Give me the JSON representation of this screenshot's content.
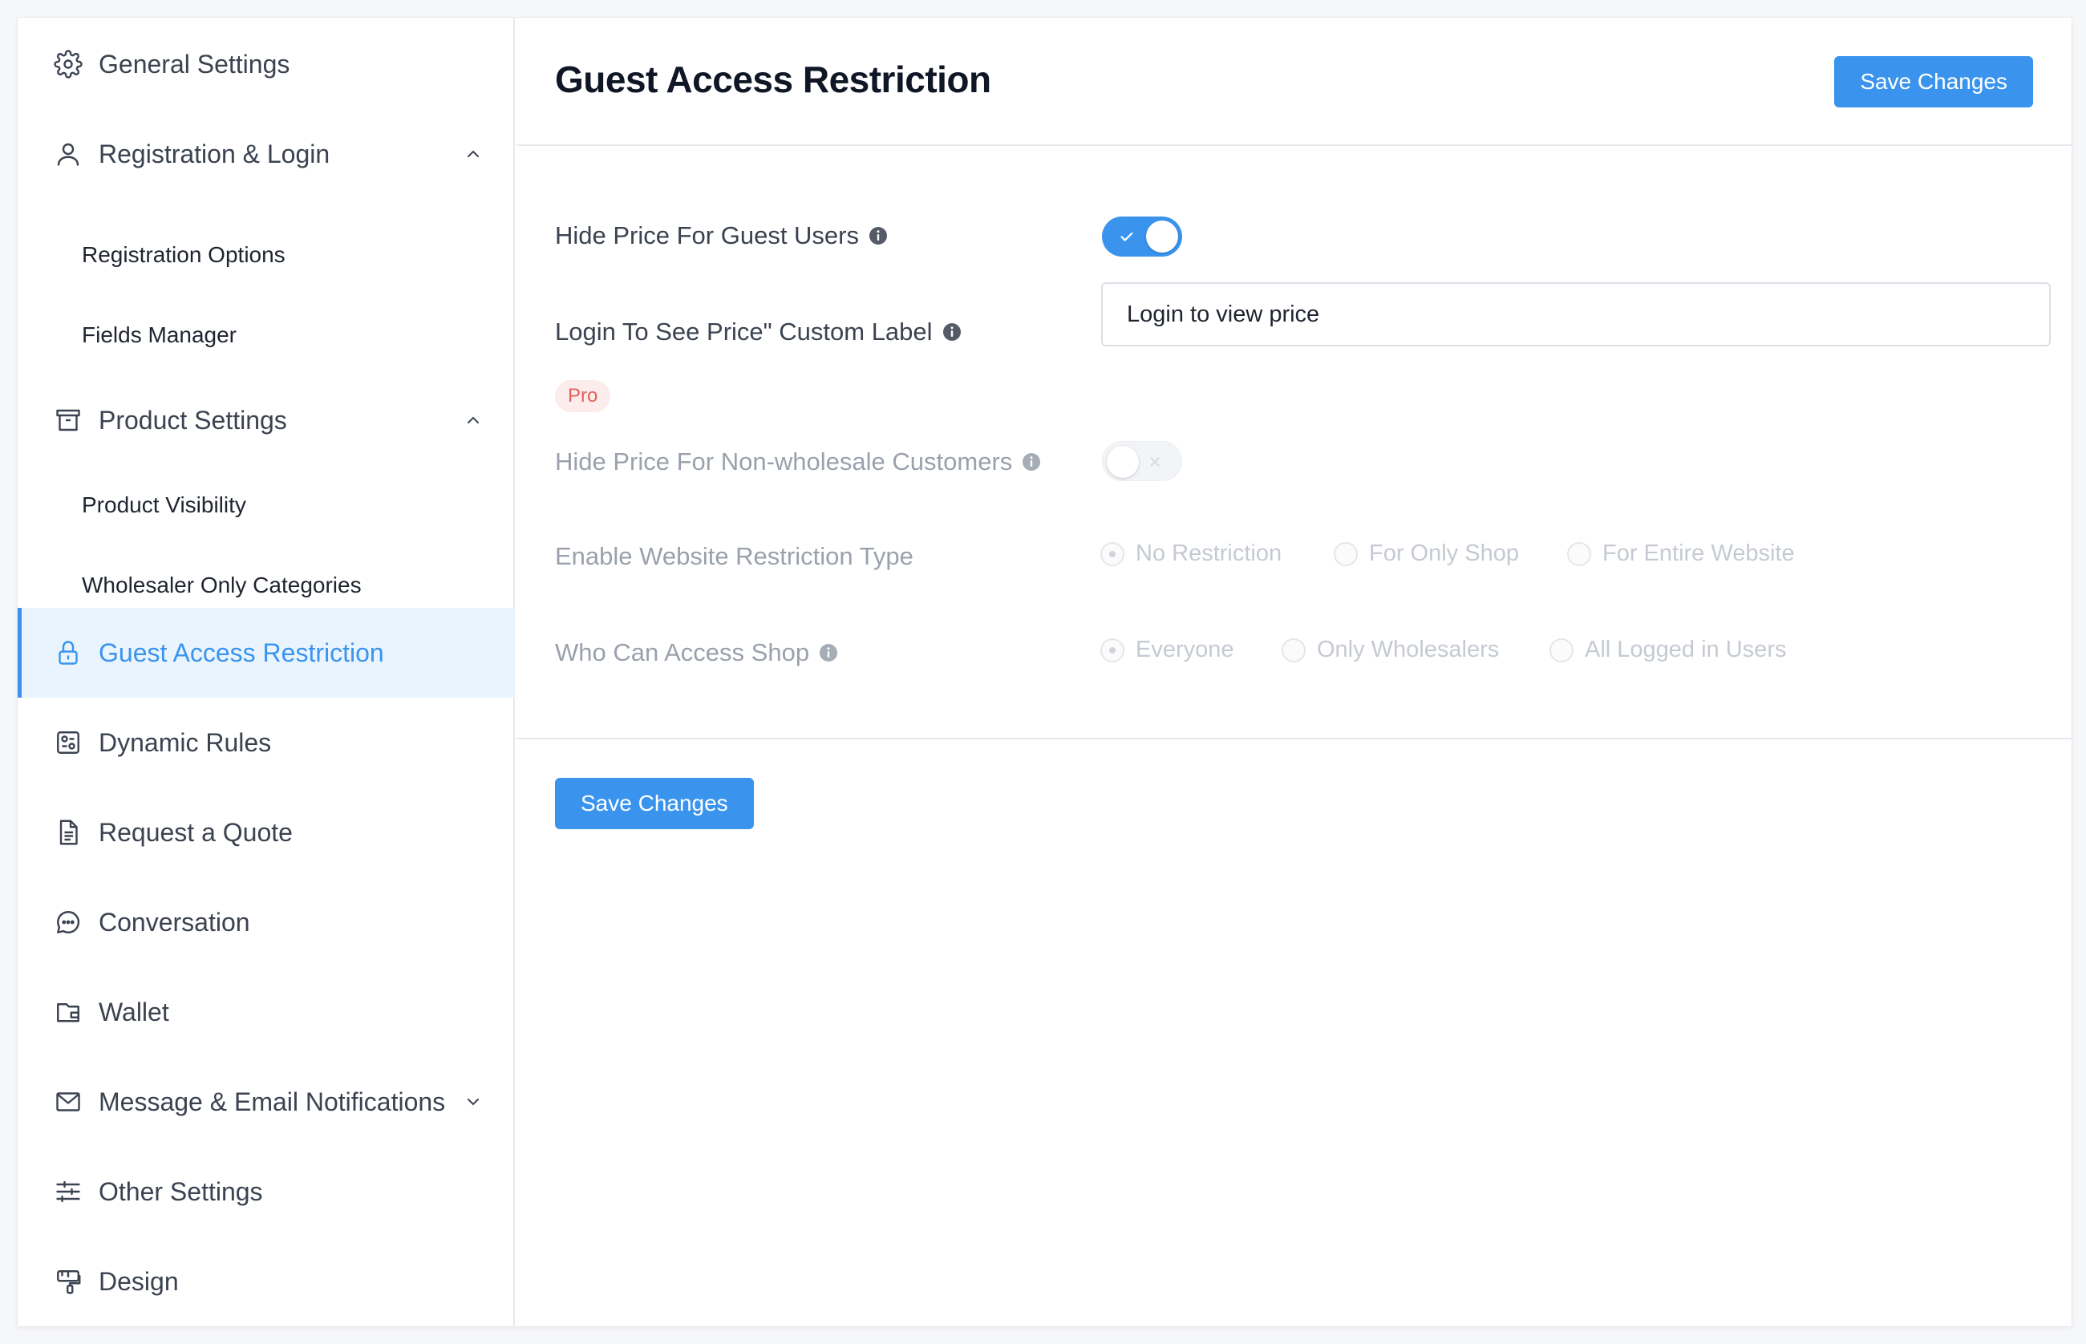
{
  "sidebar": {
    "items": [
      {
        "label": "General Settings",
        "icon": "gear-icon"
      },
      {
        "label": "Registration & Login",
        "icon": "user-icon",
        "expanded": true
      },
      {
        "label": "Registration Options"
      },
      {
        "label": "Fields Manager"
      },
      {
        "label": "Product Settings",
        "icon": "archive-box-icon",
        "expanded": true
      },
      {
        "label": "Product Visibility"
      },
      {
        "label": "Wholesaler Only Categories"
      },
      {
        "label": "Guest Access Restriction",
        "icon": "lock-icon",
        "active": true
      },
      {
        "label": "Dynamic Rules",
        "icon": "rules-icon"
      },
      {
        "label": "Request a Quote",
        "icon": "document-icon"
      },
      {
        "label": "Conversation",
        "icon": "chat-bubble-icon"
      },
      {
        "label": "Wallet",
        "icon": "wallet-icon"
      },
      {
        "label": "Message & Email Notifications",
        "icon": "envelope-icon",
        "expanded": false
      },
      {
        "label": "Other Settings",
        "icon": "sliders-icon"
      },
      {
        "label": "Design",
        "icon": "paint-roller-icon"
      }
    ]
  },
  "main": {
    "title": "Guest Access Restriction",
    "save_label": "Save Changes",
    "settings": {
      "hide_price_guest": {
        "label": "Hide Price For Guest Users",
        "enabled": true
      },
      "custom_label": {
        "label": "Login To See Price\" Custom Label",
        "value": "Login to view price"
      },
      "pro_badge": "Pro",
      "hide_price_non_wholesale": {
        "label": "Hide Price For Non-wholesale Customers",
        "enabled": false
      },
      "restriction_type": {
        "label": "Enable Website Restriction Type",
        "options": [
          "No Restriction",
          "For Only Shop",
          "For Entire Website"
        ],
        "selected": "No Restriction"
      },
      "who_can_access": {
        "label": "Who Can Access Shop",
        "options": [
          "Everyone",
          "Only Wholesalers",
          "All Logged in Users"
        ],
        "selected": "Everyone"
      }
    }
  },
  "colors": {
    "accent": "#3a94ee",
    "active_bg": "#eaf4fe",
    "pro_badge_bg": "#fdecec",
    "pro_badge_text": "#e0605a"
  }
}
